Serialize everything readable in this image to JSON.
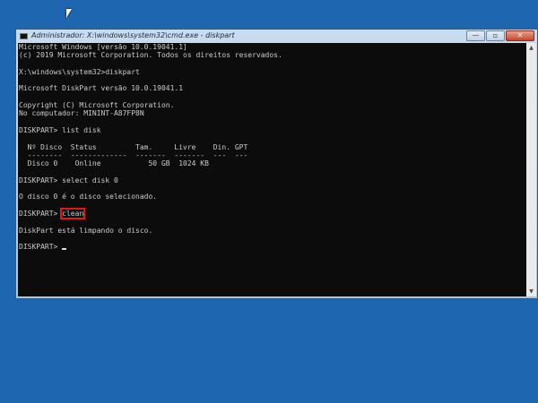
{
  "window": {
    "title": "Administrador: X:\\windows\\system32\\cmd.exe - diskpart",
    "minimize_label": "—",
    "maximize_label": "▫",
    "close_label": "✕"
  },
  "console": {
    "lines": [
      "Microsoft Windows [versão 10.0.19041.1]",
      "(c) 2019 Microsoft Corporation. Todos os direitos reservados.",
      "",
      "X:\\windows\\system32>diskpart",
      "",
      "Microsoft DiskPart versão 10.0.19041.1",
      "",
      "Copyright (C) Microsoft Corporation.",
      "No computador: MININT-A87FP8N",
      "",
      "DISKPART> list disk",
      "",
      "  Nº Disco  Status         Tam.     Livre    Din. GPT",
      "  --------  -------------  -------  -------  ---  ---",
      "  Disco 0    Online           50 GB  1024 KB",
      "",
      "DISKPART> select disk 0",
      "",
      "O disco 0 é o disco selecionado.",
      "",
      "",
      "",
      "DiskPart está limpando o disco.",
      "",
      ""
    ],
    "prompt": "DISKPART> ",
    "highlighted_command": "clean"
  },
  "scrollbar": {
    "up": "▲",
    "down": "▼"
  },
  "colors": {
    "desktop": "#1f66b0",
    "console_bg": "#0c0c0c",
    "highlight": "#e01818"
  }
}
